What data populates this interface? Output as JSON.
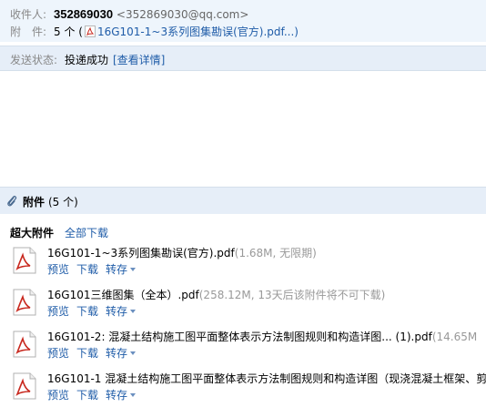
{
  "header": {
    "recipient_label": "收件人:",
    "recipient_name": "352869030",
    "recipient_email": "<352869030@qq.com>",
    "attach_label": "附　件:",
    "attach_count": "5 个 (",
    "attach_first": "16G101-1~3系列图集勘误(官方).pdf...)"
  },
  "status": {
    "label": "发送状态:",
    "value": "投递成功",
    "detail_link": "[查看详情]"
  },
  "attachments": {
    "title": "附件",
    "count": "(5 个)",
    "big_label": "超大附件",
    "download_all": "全部下载",
    "items": [
      {
        "name": "16G101-1~3系列图集勘误(官方).pdf",
        "meta": "(1.68M, 无限期)",
        "preview": "预览",
        "download": "下载",
        "save": "转存"
      },
      {
        "name": "16G101三维图集（全本）.pdf",
        "meta": "(258.12M, 13天后该附件将不可下载)",
        "preview": "预览",
        "download": "下载",
        "save": "转存"
      },
      {
        "name": "16G101-2: 混凝土结构施工图平面整体表示方法制图规则和构造详图... (1).pdf",
        "meta": "(14.65M",
        "preview": "预览",
        "download": "下载",
        "save": "转存"
      },
      {
        "name": "16G101-1 混凝土结构施工图平面整体表示方法制图规则和构造详图（现浇混凝土框架、剪",
        "meta": "",
        "preview": "预览",
        "download": "下载",
        "save": "转存"
      }
    ]
  },
  "colors": {
    "link": "#1f5ca8",
    "header_bg": "#eef5fc",
    "bar_bg": "#e6eef8",
    "pdf_red": "#c8281e"
  }
}
